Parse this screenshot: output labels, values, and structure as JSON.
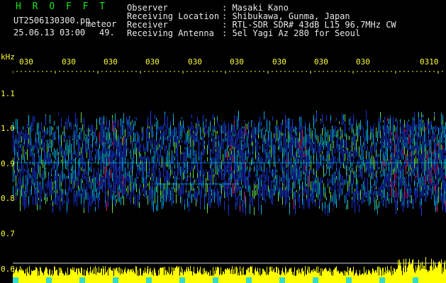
{
  "header": {
    "title": "H R O F F T",
    "filename": "UT2506130300.pn",
    "meteor_label": "meteor",
    "datetime": "25.06.13 03:00",
    "count": "49.",
    "info_labels": [
      "Observer",
      "Receiving Location",
      "Receiver",
      "Receiving Antenna"
    ],
    "info_values": [
      ": Masaki Kano",
      ": Shibukawa, Gunma, Japan",
      ": RTL-SDR SDR# 43dB L15 96.7MHz CW",
      ": 5el Yagi Az 280 for Seoul"
    ]
  },
  "axes": {
    "y_unit": "kHz",
    "y_ticks": [
      "1.1",
      "1.0",
      "0.9",
      "0.8",
      "0.7",
      "0.6"
    ],
    "x_ticks": [
      "030",
      "030",
      "030",
      "030",
      "030",
      "030",
      "030",
      "030",
      "030",
      "0310"
    ]
  },
  "colors": {
    "background": "#000000",
    "title": "#19e619",
    "labels": "#ffff33",
    "text": "#e8e8e8",
    "spectro_low": "#1a3cff",
    "spectro_mid": "#00d0ff",
    "spectro_hi": "#7cff4d",
    "spectro_peak": "#ff2080",
    "bars": "#ffff00"
  }
}
